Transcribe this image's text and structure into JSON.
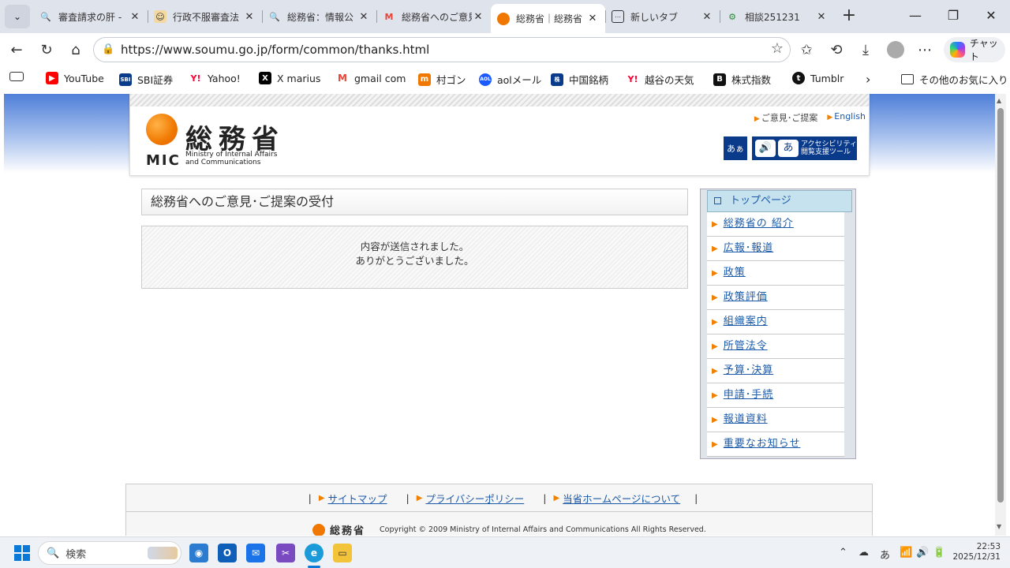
{
  "browser": {
    "tabs": [
      {
        "title": "審査請求の肝 -",
        "icon": "search-icon",
        "active": false
      },
      {
        "title": "行政不服審査法",
        "icon": "person-icon",
        "active": false
      },
      {
        "title": "総務省：情報公",
        "icon": "search-icon",
        "active": false
      },
      {
        "title": "総務省へのご意見",
        "icon": "gmail-icon",
        "active": false
      },
      {
        "title": "総務省｜総務省",
        "icon": "soumu-icon",
        "active": true
      },
      {
        "title": "新しいタブ",
        "icon": "newtab-icon",
        "active": false
      },
      {
        "title": "相談251231",
        "icon": "gear-icon",
        "active": false
      }
    ],
    "url": "https://www.soumu.go.jp/form/common/thanks.html",
    "chat_label": "チャット",
    "bookmarks": [
      {
        "label": "YouTube",
        "icon": "youtube-icon",
        "color": "#ff0000"
      },
      {
        "label": "SBI証券",
        "icon": "sbi-icon",
        "color": "#0a3a8a"
      },
      {
        "label": "Yahoo!",
        "icon": "yahoo-icon",
        "color": "#ff0033"
      },
      {
        "label": "X marius",
        "icon": "x-icon",
        "color": "#000000"
      },
      {
        "label": "gmail com",
        "icon": "gmail-icon",
        "color": "#ea4335"
      },
      {
        "label": "村ゴン",
        "icon": "murogon-icon",
        "color": "#f07800"
      },
      {
        "label": "aolメール",
        "icon": "aol-icon",
        "color": "#1a5aff"
      },
      {
        "label": "中国銘柄",
        "icon": "chinastock-icon",
        "color": "#0a3a8a"
      },
      {
        "label": "越谷の天気",
        "icon": "yahoo-icon",
        "color": "#ff0033"
      },
      {
        "label": "株式指数",
        "icon": "b-icon",
        "color": "#111111"
      },
      {
        "label": "Tumblr",
        "icon": "tumblr-icon",
        "color": "#111111"
      }
    ],
    "other_bookmarks": "その他のお気に入り"
  },
  "site": {
    "logo_jp": "総務省",
    "logo_mic": "MIC",
    "logo_en_1": "Ministry of Internal Affairs",
    "logo_en_2": "and Communications",
    "header_links": [
      "ご意見･ご提案",
      "English"
    ],
    "acc_small": "あぁ",
    "acc_tool_1": "アクセシビリティ",
    "acc_tool_2": "閲覧支援ツール",
    "page_title": "総務省へのご意見･ご提案の受付",
    "message_1": "内容が送信されました。",
    "message_2": "ありがとうございました。",
    "side_top": "トップページ",
    "side_items": [
      "総務省の 紹介",
      "広報･報道",
      "政策",
      "政策評価",
      "組織案内",
      "所管法令",
      "予算･決算",
      "申請･手続",
      "報道資料",
      "重要なお知らせ"
    ],
    "footer_links": [
      "サイトマップ",
      "プライバシーポリシー",
      "当省ホームページについて"
    ],
    "footer_logo": "総務省",
    "copyright": "Copyright © 2009 Ministry of Internal Affairs and Communications All Rights Reserved."
  },
  "taskbar": {
    "search_placeholder": "検索",
    "ime": "あ",
    "time": "22:53",
    "date": "2025/12/31"
  }
}
